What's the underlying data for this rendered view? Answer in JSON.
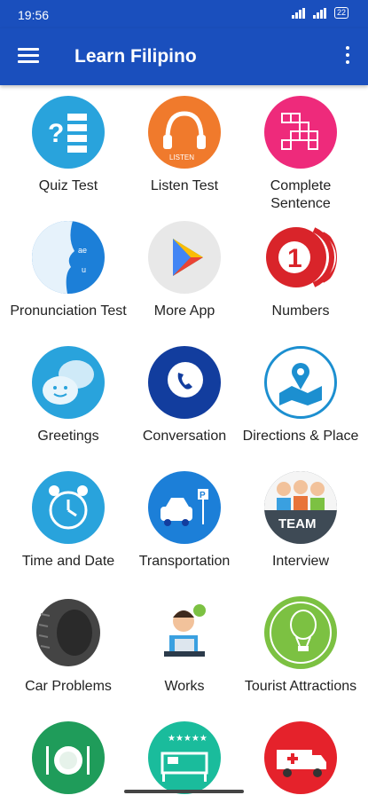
{
  "status": {
    "time": "19:56",
    "battery": "22"
  },
  "header": {
    "title": "Learn Filipino"
  },
  "tiles": [
    {
      "label": "Quiz Test",
      "icon": "quiz-icon",
      "color": "#29a3dc"
    },
    {
      "label": "Listen Test",
      "icon": "headphones-icon",
      "color": "#f07a2c"
    },
    {
      "label": "Complete Sentence",
      "icon": "crossword-icon",
      "color": "#ee2a7b"
    },
    {
      "label": "Pronunciation Test",
      "icon": "speaking-head-icon",
      "color": "#1c7fd8"
    },
    {
      "label": "More App",
      "icon": "play-store-icon",
      "color": "#e8e8e8"
    },
    {
      "label": "Numbers",
      "icon": "number-one-icon",
      "color": "#d9242a"
    },
    {
      "label": "Greetings",
      "icon": "chat-smiley-icon",
      "color": "#29a3dc"
    },
    {
      "label": "Conversation",
      "icon": "phone-chat-icon",
      "color": "#123d9e"
    },
    {
      "label": "Directions & Place",
      "icon": "map-pin-icon",
      "color": "#ffffff"
    },
    {
      "label": "Time and Date",
      "icon": "alarm-clock-icon",
      "color": "#29a3dc"
    },
    {
      "label": "Transportation",
      "icon": "car-parking-icon",
      "color": "#1c7fd8"
    },
    {
      "label": "Interview",
      "icon": "team-icon",
      "color": "#3e4a55"
    },
    {
      "label": "Car Problems",
      "icon": "tire-icon",
      "color": "#444444"
    },
    {
      "label": "Works",
      "icon": "office-worker-icon",
      "color": "#ffffff"
    },
    {
      "label": "Tourist Attractions",
      "icon": "hot-air-balloon-icon",
      "color": "#7cc142"
    },
    {
      "label": "",
      "icon": "dining-plate-icon",
      "color": "#1f9c5a"
    },
    {
      "label": "",
      "icon": "hotel-bed-icon",
      "color": "#1abc9c"
    },
    {
      "label": "",
      "icon": "ambulance-icon",
      "color": "#e5222b"
    }
  ]
}
